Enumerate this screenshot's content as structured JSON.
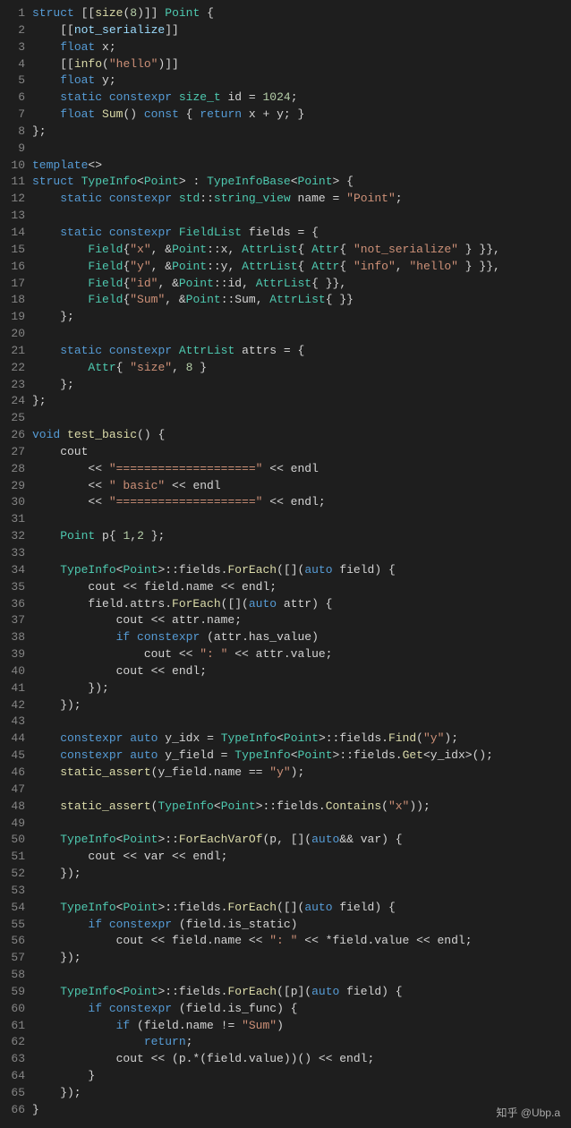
{
  "watermark": "知乎 @Ubp.a",
  "lines": [
    {
      "n": 1,
      "t": [
        [
          "kw",
          "struct"
        ],
        [
          "pn",
          " [["
        ],
        [
          "fn",
          "size"
        ],
        [
          "pn",
          "("
        ],
        [
          "nm",
          "8"
        ],
        [
          "pn",
          ")]] "
        ],
        [
          "ty",
          "Point"
        ],
        [
          "pn",
          " {"
        ]
      ]
    },
    {
      "n": 2,
      "t": [
        [
          "pn",
          "    [["
        ],
        [
          "vb",
          "not_serialize"
        ],
        [
          "pn",
          "]]"
        ]
      ]
    },
    {
      "n": 3,
      "t": [
        [
          "pn",
          "    "
        ],
        [
          "kw",
          "float"
        ],
        [
          "pn",
          " x;"
        ]
      ]
    },
    {
      "n": 4,
      "t": [
        [
          "pn",
          "    [["
        ],
        [
          "fn",
          "info"
        ],
        [
          "pn",
          "("
        ],
        [
          "st",
          "\"hello\""
        ],
        [
          "pn",
          ")]]"
        ]
      ]
    },
    {
      "n": 5,
      "t": [
        [
          "pn",
          "    "
        ],
        [
          "kw",
          "float"
        ],
        [
          "pn",
          " y;"
        ]
      ]
    },
    {
      "n": 6,
      "t": [
        [
          "pn",
          "    "
        ],
        [
          "kw",
          "static"
        ],
        [
          "pn",
          " "
        ],
        [
          "kw",
          "constexpr"
        ],
        [
          "pn",
          " "
        ],
        [
          "ty",
          "size_t"
        ],
        [
          "pn",
          " id = "
        ],
        [
          "nm",
          "1024"
        ],
        [
          "pn",
          ";"
        ]
      ]
    },
    {
      "n": 7,
      "t": [
        [
          "pn",
          "    "
        ],
        [
          "kw",
          "float"
        ],
        [
          "pn",
          " "
        ],
        [
          "fn",
          "Sum"
        ],
        [
          "pn",
          "() "
        ],
        [
          "kw",
          "const"
        ],
        [
          "pn",
          " { "
        ],
        [
          "kw",
          "return"
        ],
        [
          "pn",
          " x + y; }"
        ]
      ]
    },
    {
      "n": 8,
      "t": [
        [
          "pn",
          "};"
        ]
      ]
    },
    {
      "n": 9,
      "t": [
        [
          "pn",
          ""
        ]
      ]
    },
    {
      "n": 10,
      "t": [
        [
          "kw",
          "template"
        ],
        [
          "pn",
          "<>"
        ]
      ]
    },
    {
      "n": 11,
      "t": [
        [
          "kw",
          "struct"
        ],
        [
          "pn",
          " "
        ],
        [
          "ty",
          "TypeInfo"
        ],
        [
          "pn",
          "<"
        ],
        [
          "ty",
          "Point"
        ],
        [
          "pn",
          "> : "
        ],
        [
          "ty",
          "TypeInfoBase"
        ],
        [
          "pn",
          "<"
        ],
        [
          "ty",
          "Point"
        ],
        [
          "pn",
          "> {"
        ]
      ]
    },
    {
      "n": 12,
      "t": [
        [
          "pn",
          "    "
        ],
        [
          "kw",
          "static"
        ],
        [
          "pn",
          " "
        ],
        [
          "kw",
          "constexpr"
        ],
        [
          "pn",
          " "
        ],
        [
          "ty",
          "std"
        ],
        [
          "pn",
          "::"
        ],
        [
          "ty",
          "string_view"
        ],
        [
          "pn",
          " name = "
        ],
        [
          "st",
          "\"Point\""
        ],
        [
          "pn",
          ";"
        ]
      ]
    },
    {
      "n": 13,
      "t": [
        [
          "pn",
          ""
        ]
      ]
    },
    {
      "n": 14,
      "t": [
        [
          "pn",
          "    "
        ],
        [
          "kw",
          "static"
        ],
        [
          "pn",
          " "
        ],
        [
          "kw",
          "constexpr"
        ],
        [
          "pn",
          " "
        ],
        [
          "ty",
          "FieldList"
        ],
        [
          "pn",
          " fields = {"
        ]
      ]
    },
    {
      "n": 15,
      "t": [
        [
          "pn",
          "        "
        ],
        [
          "ty",
          "Field"
        ],
        [
          "pn",
          "{"
        ],
        [
          "st",
          "\"x\""
        ],
        [
          "pn",
          ", &"
        ],
        [
          "ty",
          "Point"
        ],
        [
          "pn",
          "::x, "
        ],
        [
          "ty",
          "AttrList"
        ],
        [
          "pn",
          "{ "
        ],
        [
          "ty",
          "Attr"
        ],
        [
          "pn",
          "{ "
        ],
        [
          "st",
          "\"not_serialize\""
        ],
        [
          "pn",
          " } }},"
        ]
      ]
    },
    {
      "n": 16,
      "t": [
        [
          "pn",
          "        "
        ],
        [
          "ty",
          "Field"
        ],
        [
          "pn",
          "{"
        ],
        [
          "st",
          "\"y\""
        ],
        [
          "pn",
          ", &"
        ],
        [
          "ty",
          "Point"
        ],
        [
          "pn",
          "::y, "
        ],
        [
          "ty",
          "AttrList"
        ],
        [
          "pn",
          "{ "
        ],
        [
          "ty",
          "Attr"
        ],
        [
          "pn",
          "{ "
        ],
        [
          "st",
          "\"info\""
        ],
        [
          "pn",
          ", "
        ],
        [
          "st",
          "\"hello\""
        ],
        [
          "pn",
          " } }},"
        ]
      ]
    },
    {
      "n": 17,
      "t": [
        [
          "pn",
          "        "
        ],
        [
          "ty",
          "Field"
        ],
        [
          "pn",
          "{"
        ],
        [
          "st",
          "\"id\""
        ],
        [
          "pn",
          ", &"
        ],
        [
          "ty",
          "Point"
        ],
        [
          "pn",
          "::id, "
        ],
        [
          "ty",
          "AttrList"
        ],
        [
          "pn",
          "{ }},"
        ]
      ]
    },
    {
      "n": 18,
      "t": [
        [
          "pn",
          "        "
        ],
        [
          "ty",
          "Field"
        ],
        [
          "pn",
          "{"
        ],
        [
          "st",
          "\"Sum\""
        ],
        [
          "pn",
          ", &"
        ],
        [
          "ty",
          "Point"
        ],
        [
          "pn",
          "::Sum, "
        ],
        [
          "ty",
          "AttrList"
        ],
        [
          "pn",
          "{ }}"
        ]
      ]
    },
    {
      "n": 19,
      "t": [
        [
          "pn",
          "    };"
        ]
      ]
    },
    {
      "n": 20,
      "t": [
        [
          "pn",
          ""
        ]
      ]
    },
    {
      "n": 21,
      "t": [
        [
          "pn",
          "    "
        ],
        [
          "kw",
          "static"
        ],
        [
          "pn",
          " "
        ],
        [
          "kw",
          "constexpr"
        ],
        [
          "pn",
          " "
        ],
        [
          "ty",
          "AttrList"
        ],
        [
          "pn",
          " attrs = {"
        ]
      ]
    },
    {
      "n": 22,
      "t": [
        [
          "pn",
          "        "
        ],
        [
          "ty",
          "Attr"
        ],
        [
          "pn",
          "{ "
        ],
        [
          "st",
          "\"size\""
        ],
        [
          "pn",
          ", "
        ],
        [
          "nm",
          "8"
        ],
        [
          "pn",
          " }"
        ]
      ]
    },
    {
      "n": 23,
      "t": [
        [
          "pn",
          "    };"
        ]
      ]
    },
    {
      "n": 24,
      "t": [
        [
          "pn",
          "};"
        ]
      ]
    },
    {
      "n": 25,
      "t": [
        [
          "pn",
          ""
        ]
      ]
    },
    {
      "n": 26,
      "t": [
        [
          "kw",
          "void"
        ],
        [
          "pn",
          " "
        ],
        [
          "fn",
          "test_basic"
        ],
        [
          "pn",
          "() {"
        ]
      ]
    },
    {
      "n": 27,
      "t": [
        [
          "pn",
          "    cout"
        ]
      ]
    },
    {
      "n": 28,
      "t": [
        [
          "pn",
          "        << "
        ],
        [
          "st",
          "\"====================\""
        ],
        [
          "pn",
          " << endl"
        ]
      ]
    },
    {
      "n": 29,
      "t": [
        [
          "pn",
          "        << "
        ],
        [
          "st",
          "\" basic\""
        ],
        [
          "pn",
          " << endl"
        ]
      ]
    },
    {
      "n": 30,
      "t": [
        [
          "pn",
          "        << "
        ],
        [
          "st",
          "\"====================\""
        ],
        [
          "pn",
          " << endl;"
        ]
      ]
    },
    {
      "n": 31,
      "t": [
        [
          "pn",
          ""
        ]
      ]
    },
    {
      "n": 32,
      "t": [
        [
          "pn",
          "    "
        ],
        [
          "ty",
          "Point"
        ],
        [
          "pn",
          " p{ "
        ],
        [
          "nm",
          "1"
        ],
        [
          "pn",
          ","
        ],
        [
          "nm",
          "2"
        ],
        [
          "pn",
          " };"
        ]
      ]
    },
    {
      "n": 33,
      "t": [
        [
          "pn",
          ""
        ]
      ]
    },
    {
      "n": 34,
      "t": [
        [
          "pn",
          "    "
        ],
        [
          "ty",
          "TypeInfo"
        ],
        [
          "pn",
          "<"
        ],
        [
          "ty",
          "Point"
        ],
        [
          "pn",
          ">::fields."
        ],
        [
          "fn",
          "ForEach"
        ],
        [
          "pn",
          "([]("
        ],
        [
          "kw",
          "auto"
        ],
        [
          "pn",
          " field) {"
        ]
      ]
    },
    {
      "n": 35,
      "t": [
        [
          "pn",
          "        cout << field.name << endl;"
        ]
      ]
    },
    {
      "n": 36,
      "t": [
        [
          "pn",
          "        field.attrs."
        ],
        [
          "fn",
          "ForEach"
        ],
        [
          "pn",
          "([]("
        ],
        [
          "kw",
          "auto"
        ],
        [
          "pn",
          " attr) {"
        ]
      ]
    },
    {
      "n": 37,
      "t": [
        [
          "pn",
          "            cout << attr.name;"
        ]
      ]
    },
    {
      "n": 38,
      "t": [
        [
          "pn",
          "            "
        ],
        [
          "kw",
          "if"
        ],
        [
          "pn",
          " "
        ],
        [
          "kw",
          "constexpr"
        ],
        [
          "pn",
          " (attr.has_value)"
        ]
      ]
    },
    {
      "n": 39,
      "t": [
        [
          "pn",
          "                cout << "
        ],
        [
          "st",
          "\": \""
        ],
        [
          "pn",
          " << attr.value;"
        ]
      ]
    },
    {
      "n": 40,
      "t": [
        [
          "pn",
          "            cout << endl;"
        ]
      ]
    },
    {
      "n": 41,
      "t": [
        [
          "pn",
          "        });"
        ]
      ]
    },
    {
      "n": 42,
      "t": [
        [
          "pn",
          "    });"
        ]
      ]
    },
    {
      "n": 43,
      "t": [
        [
          "pn",
          ""
        ]
      ]
    },
    {
      "n": 44,
      "t": [
        [
          "pn",
          "    "
        ],
        [
          "kw",
          "constexpr"
        ],
        [
          "pn",
          " "
        ],
        [
          "kw",
          "auto"
        ],
        [
          "pn",
          " y_idx = "
        ],
        [
          "ty",
          "TypeInfo"
        ],
        [
          "pn",
          "<"
        ],
        [
          "ty",
          "Point"
        ],
        [
          "pn",
          ">::fields."
        ],
        [
          "fn",
          "Find"
        ],
        [
          "pn",
          "("
        ],
        [
          "st",
          "\"y\""
        ],
        [
          "pn",
          ");"
        ]
      ]
    },
    {
      "n": 45,
      "t": [
        [
          "pn",
          "    "
        ],
        [
          "kw",
          "constexpr"
        ],
        [
          "pn",
          " "
        ],
        [
          "kw",
          "auto"
        ],
        [
          "pn",
          " y_field = "
        ],
        [
          "ty",
          "TypeInfo"
        ],
        [
          "pn",
          "<"
        ],
        [
          "ty",
          "Point"
        ],
        [
          "pn",
          ">::fields."
        ],
        [
          "fn",
          "Get"
        ],
        [
          "pn",
          "<y_idx>();"
        ]
      ]
    },
    {
      "n": 46,
      "t": [
        [
          "pn",
          "    "
        ],
        [
          "fn",
          "static_assert"
        ],
        [
          "pn",
          "(y_field.name == "
        ],
        [
          "st",
          "\"y\""
        ],
        [
          "pn",
          ");"
        ]
      ]
    },
    {
      "n": 47,
      "t": [
        [
          "pn",
          ""
        ]
      ]
    },
    {
      "n": 48,
      "t": [
        [
          "pn",
          "    "
        ],
        [
          "fn",
          "static_assert"
        ],
        [
          "pn",
          "("
        ],
        [
          "ty",
          "TypeInfo"
        ],
        [
          "pn",
          "<"
        ],
        [
          "ty",
          "Point"
        ],
        [
          "pn",
          ">::fields."
        ],
        [
          "fn",
          "Contains"
        ],
        [
          "pn",
          "("
        ],
        [
          "st",
          "\"x\""
        ],
        [
          "pn",
          "));"
        ]
      ]
    },
    {
      "n": 49,
      "t": [
        [
          "pn",
          ""
        ]
      ]
    },
    {
      "n": 50,
      "t": [
        [
          "pn",
          "    "
        ],
        [
          "ty",
          "TypeInfo"
        ],
        [
          "pn",
          "<"
        ],
        [
          "ty",
          "Point"
        ],
        [
          "pn",
          ">::"
        ],
        [
          "fn",
          "ForEachVarOf"
        ],
        [
          "pn",
          "(p, []("
        ],
        [
          "kw",
          "auto"
        ],
        [
          "pn",
          "&& var) {"
        ]
      ]
    },
    {
      "n": 51,
      "t": [
        [
          "pn",
          "        cout << var << endl;"
        ]
      ]
    },
    {
      "n": 52,
      "t": [
        [
          "pn",
          "    });"
        ]
      ]
    },
    {
      "n": 53,
      "t": [
        [
          "pn",
          ""
        ]
      ]
    },
    {
      "n": 54,
      "t": [
        [
          "pn",
          "    "
        ],
        [
          "ty",
          "TypeInfo"
        ],
        [
          "pn",
          "<"
        ],
        [
          "ty",
          "Point"
        ],
        [
          "pn",
          ">::fields."
        ],
        [
          "fn",
          "ForEach"
        ],
        [
          "pn",
          "([]("
        ],
        [
          "kw",
          "auto"
        ],
        [
          "pn",
          " field) {"
        ]
      ]
    },
    {
      "n": 55,
      "t": [
        [
          "pn",
          "        "
        ],
        [
          "kw",
          "if"
        ],
        [
          "pn",
          " "
        ],
        [
          "kw",
          "constexpr"
        ],
        [
          "pn",
          " (field.is_static)"
        ]
      ]
    },
    {
      "n": 56,
      "t": [
        [
          "pn",
          "            cout << field.name << "
        ],
        [
          "st",
          "\": \""
        ],
        [
          "pn",
          " << *field.value << endl;"
        ]
      ]
    },
    {
      "n": 57,
      "t": [
        [
          "pn",
          "    });"
        ]
      ]
    },
    {
      "n": 58,
      "t": [
        [
          "pn",
          ""
        ]
      ]
    },
    {
      "n": 59,
      "t": [
        [
          "pn",
          "    "
        ],
        [
          "ty",
          "TypeInfo"
        ],
        [
          "pn",
          "<"
        ],
        [
          "ty",
          "Point"
        ],
        [
          "pn",
          ">::fields."
        ],
        [
          "fn",
          "ForEach"
        ],
        [
          "pn",
          "([p]("
        ],
        [
          "kw",
          "auto"
        ],
        [
          "pn",
          " field) {"
        ]
      ]
    },
    {
      "n": 60,
      "t": [
        [
          "pn",
          "        "
        ],
        [
          "kw",
          "if"
        ],
        [
          "pn",
          " "
        ],
        [
          "kw",
          "constexpr"
        ],
        [
          "pn",
          " (field.is_func) {"
        ]
      ]
    },
    {
      "n": 61,
      "t": [
        [
          "pn",
          "            "
        ],
        [
          "kw",
          "if"
        ],
        [
          "pn",
          " (field.name != "
        ],
        [
          "st",
          "\"Sum\""
        ],
        [
          "pn",
          ")"
        ]
      ]
    },
    {
      "n": 62,
      "t": [
        [
          "pn",
          "                "
        ],
        [
          "kw",
          "return"
        ],
        [
          "pn",
          ";"
        ]
      ]
    },
    {
      "n": 63,
      "t": [
        [
          "pn",
          "            cout << (p.*(field.value))() << endl;"
        ]
      ]
    },
    {
      "n": 64,
      "t": [
        [
          "pn",
          "        }"
        ]
      ]
    },
    {
      "n": 65,
      "t": [
        [
          "pn",
          "    });"
        ]
      ]
    },
    {
      "n": 66,
      "t": [
        [
          "pn",
          "}"
        ]
      ]
    }
  ]
}
